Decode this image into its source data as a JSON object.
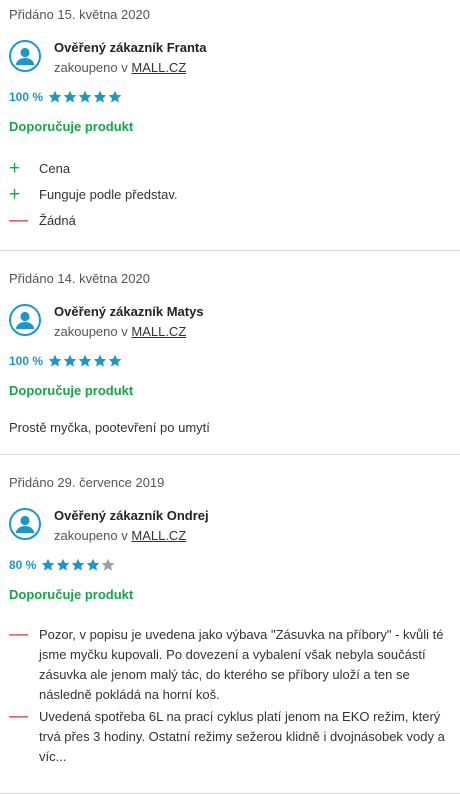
{
  "reviews": [
    {
      "added": "Přidáno 15. května 2020",
      "author": "Ověřený zákazník Franta",
      "bought_prefix": "zakoupeno v",
      "shop": "MALL.CZ",
      "rating_pct": "100 %",
      "stars": 5,
      "recommend": "Doporučuje produkt",
      "pros": [
        "Cena",
        "Funguje podle představ."
      ],
      "cons": [
        "Žádná"
      ]
    },
    {
      "added": "Přidáno 14. května 2020",
      "author": "Ověřený zákazník Matys",
      "bought_prefix": "zakoupeno v",
      "shop": "MALL.CZ",
      "rating_pct": "100 %",
      "stars": 5,
      "recommend": "Doporučuje produkt",
      "comment": "Prostě myčka, pootevření po umytí"
    },
    {
      "added": "Přidáno 29. července 2019",
      "author": "Ověřený zákazník Ondrej",
      "bought_prefix": "zakoupeno v",
      "shop": "MALL.CZ",
      "rating_pct": "80 %",
      "stars": 4,
      "recommend": "Doporučuje produkt",
      "cons": [
        "Pozor, v popisu je uvedena jako výbava \"Zásuvka na příbory\" - kvůli té jsme myčku kupovali. Po dovezení a vybalení však nebyla součástí zásuvka ale jenom malý tác, do kterého se příbory uloží a ten se následně pokládá na horní koš.",
        "Uvedená spotřeba 6L na prací cyklus platí jenom na EKO režim, který trvá přes 3 hodiny. Ostatní režimy sežerou klidně i dvojnásobek vody a víc..."
      ]
    }
  ],
  "colors": {
    "accent": "#1e96c8",
    "positive": "#1aa34a",
    "negative": "#e0303a",
    "star_empty": "#9e9e9e"
  },
  "icons": {
    "avatar": "user-avatar-icon",
    "star": "star-icon",
    "plus": "plus-icon",
    "minus": "minus-icon"
  }
}
